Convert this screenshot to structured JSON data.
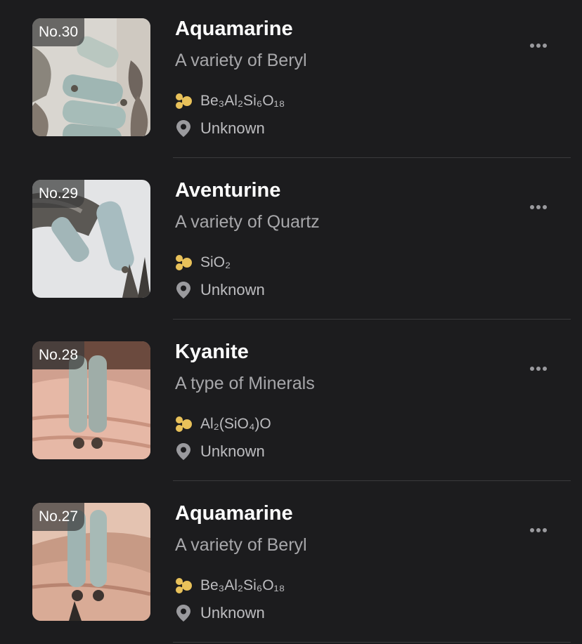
{
  "items": [
    {
      "badge": "No.30",
      "name": "Aquamarine",
      "subtitle": "A variety of Beryl",
      "formula": "Be₃Al₂Si₆O₁₈",
      "location": "Unknown"
    },
    {
      "badge": "No.29",
      "name": "Aventurine",
      "subtitle": "A variety of Quartz",
      "formula": "SiO₂",
      "location": "Unknown"
    },
    {
      "badge": "No.28",
      "name": "Kyanite",
      "subtitle": "A type of Minerals",
      "formula": "Al₂(SiO₄)O",
      "location": "Unknown"
    },
    {
      "badge": "No.27",
      "name": "Aquamarine",
      "subtitle": "A variety of Beryl",
      "formula": "Be₃Al₂Si₆O₁₈",
      "location": "Unknown"
    }
  ],
  "colors": {
    "background": "#1c1c1e",
    "formula_icon": "#e8c15a",
    "secondary_text": "#a7a7aa",
    "divider": "#3a3a3c"
  },
  "icons": {
    "formula": "molecule-icon",
    "location": "map-pin-icon",
    "more": "more-horizontal-icon"
  }
}
